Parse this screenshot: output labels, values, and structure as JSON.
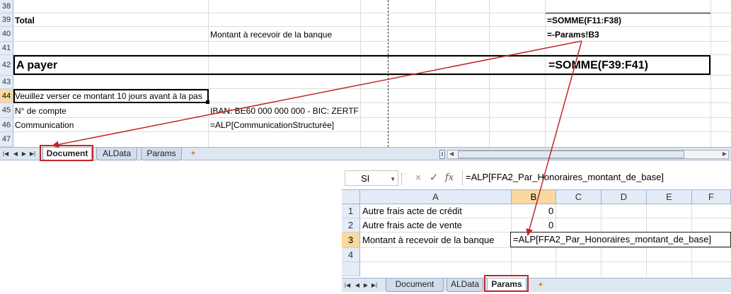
{
  "top_sheet": {
    "rows": [
      "38",
      "39",
      "40",
      "41",
      "42",
      "43",
      "44",
      "45",
      "46",
      "47"
    ],
    "selected_row": "44",
    "cells": {
      "total_label": "Total",
      "total_formula": "=SOMME(F11:F38)",
      "bank_label": "Montant à recevoir de la banque",
      "bank_formula": "=-Params!B3",
      "pay_label": "A payer",
      "pay_formula": "=SOMME(F39:F41)",
      "notice": "Veuillez verser ce montant 10 jours avant à la pas",
      "account_label": "N° de compte",
      "account_value": "IBAN: BE60 000 000 000 - BIC: ZERTF",
      "communication_label": "Communication",
      "communication_value": "=ALP[CommunicationStructurée]"
    },
    "tabs": [
      {
        "label": "Document",
        "active": true
      },
      {
        "label": "ALData",
        "active": false
      },
      {
        "label": "Params",
        "active": false
      }
    ]
  },
  "params_window": {
    "name_box": "SI",
    "formula_bar": "=ALP[FFA2_Par_Honoraires_montant_de_base]",
    "columns": [
      "A",
      "B",
      "C",
      "D",
      "E",
      "F"
    ],
    "selected_column": "B",
    "rows": [
      "1",
      "2",
      "3",
      "4"
    ],
    "selected_row": "3",
    "cells": [
      {
        "label": "Autre frais acte de crédit",
        "value": "0"
      },
      {
        "label": "Autre frais acte de vente",
        "value": "0"
      },
      {
        "label": "Montant à recevoir de la banque",
        "value": "=ALP[FFA2_Par_Honoraires_montant_de_base]"
      }
    ],
    "tabs": [
      {
        "label": "Document",
        "active": false
      },
      {
        "label": "ALData",
        "active": false
      },
      {
        "label": "Params",
        "active": true
      }
    ]
  },
  "icons": {
    "cancel": "×",
    "enter": "✓",
    "function": "fx",
    "first": "◀",
    "last": "▶",
    "new_sheet": "✦"
  },
  "colors": {
    "highlight_box": "#c0262b",
    "arrow": "#c0262b",
    "header_selected": "#f9d99f"
  }
}
